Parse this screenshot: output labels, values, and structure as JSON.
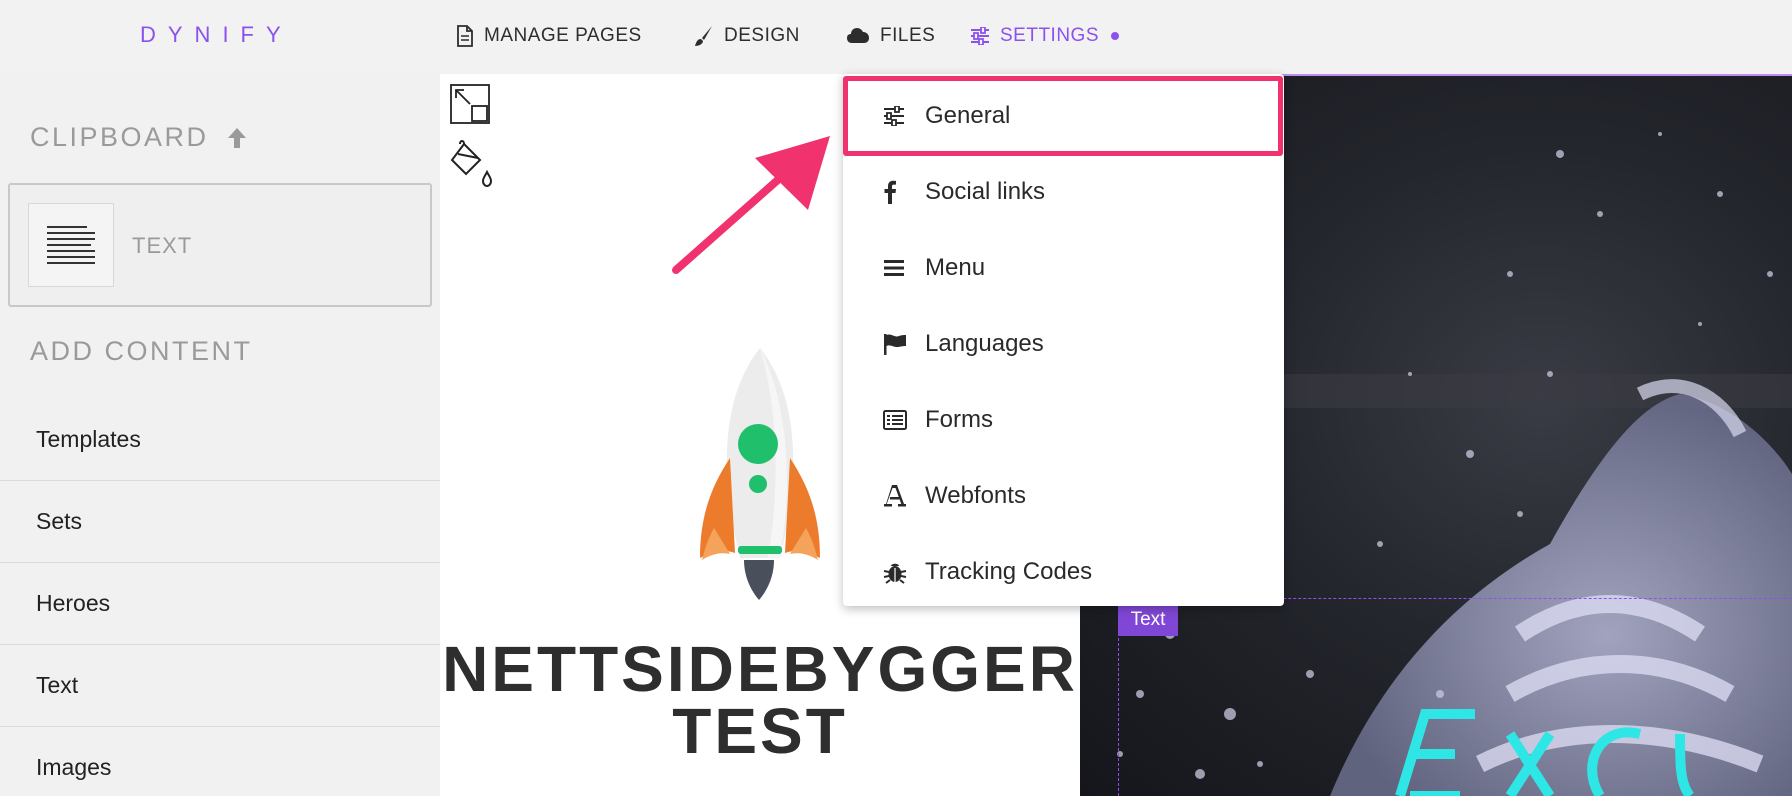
{
  "app": {
    "logo": "DYNIFY"
  },
  "nav": [
    {
      "label": "MANAGE PAGES",
      "icon": "document-icon"
    },
    {
      "label": "DESIGN",
      "icon": "brush-icon"
    },
    {
      "label": "FILES",
      "icon": "cloud-icon"
    },
    {
      "label": "SETTINGS",
      "icon": "sliders-icon",
      "active": true
    }
  ],
  "sidebar": {
    "clipboard_title": "CLIPBOARD",
    "clipboard_item": "TEXT",
    "add_content_title": "ADD CONTENT",
    "items": [
      "Templates",
      "Sets",
      "Heroes",
      "Text",
      "Images"
    ]
  },
  "canvas": {
    "site_title_line1": "NETTSIDEBYGGER",
    "site_title_line2": "TEST",
    "text_badge": "Text"
  },
  "settings_menu": {
    "items": [
      {
        "label": "General",
        "icon": "sliders-icon",
        "highlighted": true
      },
      {
        "label": "Social links",
        "icon": "facebook-icon"
      },
      {
        "label": "Menu",
        "icon": "hamburger-icon"
      },
      {
        "label": "Languages",
        "icon": "flag-icon"
      },
      {
        "label": "Forms",
        "icon": "form-list-icon"
      },
      {
        "label": "Webfonts",
        "icon": "font-icon"
      },
      {
        "label": "Tracking Codes",
        "icon": "bug-icon"
      }
    ]
  },
  "colors": {
    "accent": "#8c52ee",
    "highlight": "#f0336f",
    "hero_text": "#2ee6e6"
  }
}
